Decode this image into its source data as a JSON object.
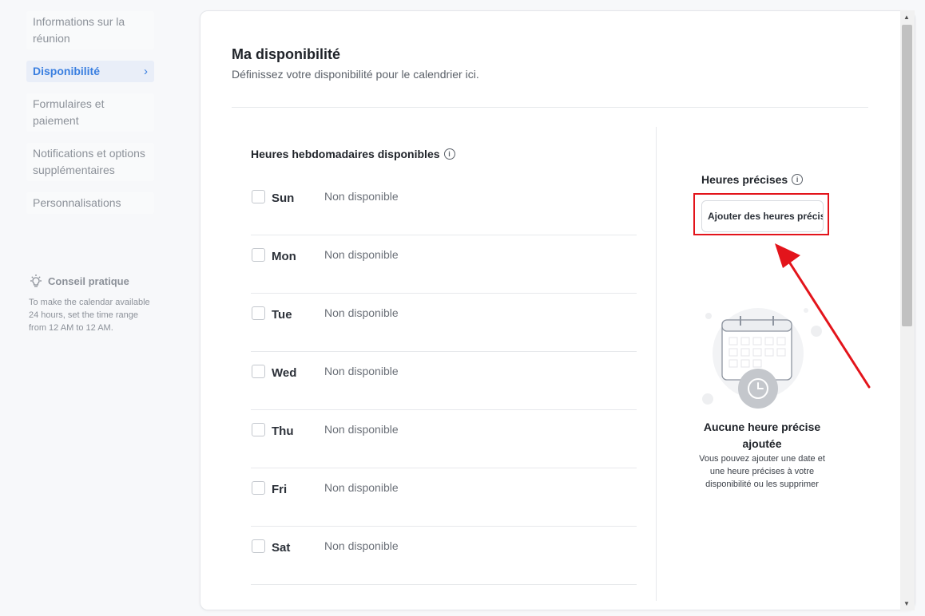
{
  "sidebar": {
    "items": [
      {
        "label": "Informations sur la réunion"
      },
      {
        "label": "Disponibilité",
        "active": true
      },
      {
        "label": "Formulaires et paiement"
      },
      {
        "label": "Notifications et options supplémentaires"
      },
      {
        "label": "Personnalisations"
      }
    ],
    "active_chevron": "›"
  },
  "tip": {
    "title": "Conseil pratique",
    "text": "To make the calendar available 24 hours, set the time range from 12 AM to 12 AM.",
    "icon": "lightbulb-icon"
  },
  "main": {
    "title": "Ma disponibilité",
    "subtitle": "Définissez votre disponibilité pour le calendrier ici.",
    "weekly": {
      "title": "Heures hebdomadaires disponibles",
      "info_glyph": "i",
      "days": [
        {
          "name": "Sun",
          "status": "Non disponible",
          "checked": false
        },
        {
          "name": "Mon",
          "status": "Non disponible",
          "checked": false
        },
        {
          "name": "Tue",
          "status": "Non disponible",
          "checked": false
        },
        {
          "name": "Wed",
          "status": "Non disponible",
          "checked": false
        },
        {
          "name": "Thu",
          "status": "Non disponible",
          "checked": false
        },
        {
          "name": "Fri",
          "status": "Non disponible",
          "checked": false
        },
        {
          "name": "Sat",
          "status": "Non disponible",
          "checked": false
        }
      ]
    },
    "precise": {
      "title": "Heures précises",
      "info_glyph": "i",
      "button_label": "Ajouter des heures précises",
      "empty_title": "Aucune heure précise ajoutée",
      "empty_text": "Vous pouvez ajouter une date et une heure précises à votre disponibilité ou les supprimer"
    }
  },
  "colors": {
    "accent": "#3a7fe0",
    "highlight_red": "#e3141b"
  },
  "scrollbar": {
    "up": "▲",
    "down": "▼"
  }
}
